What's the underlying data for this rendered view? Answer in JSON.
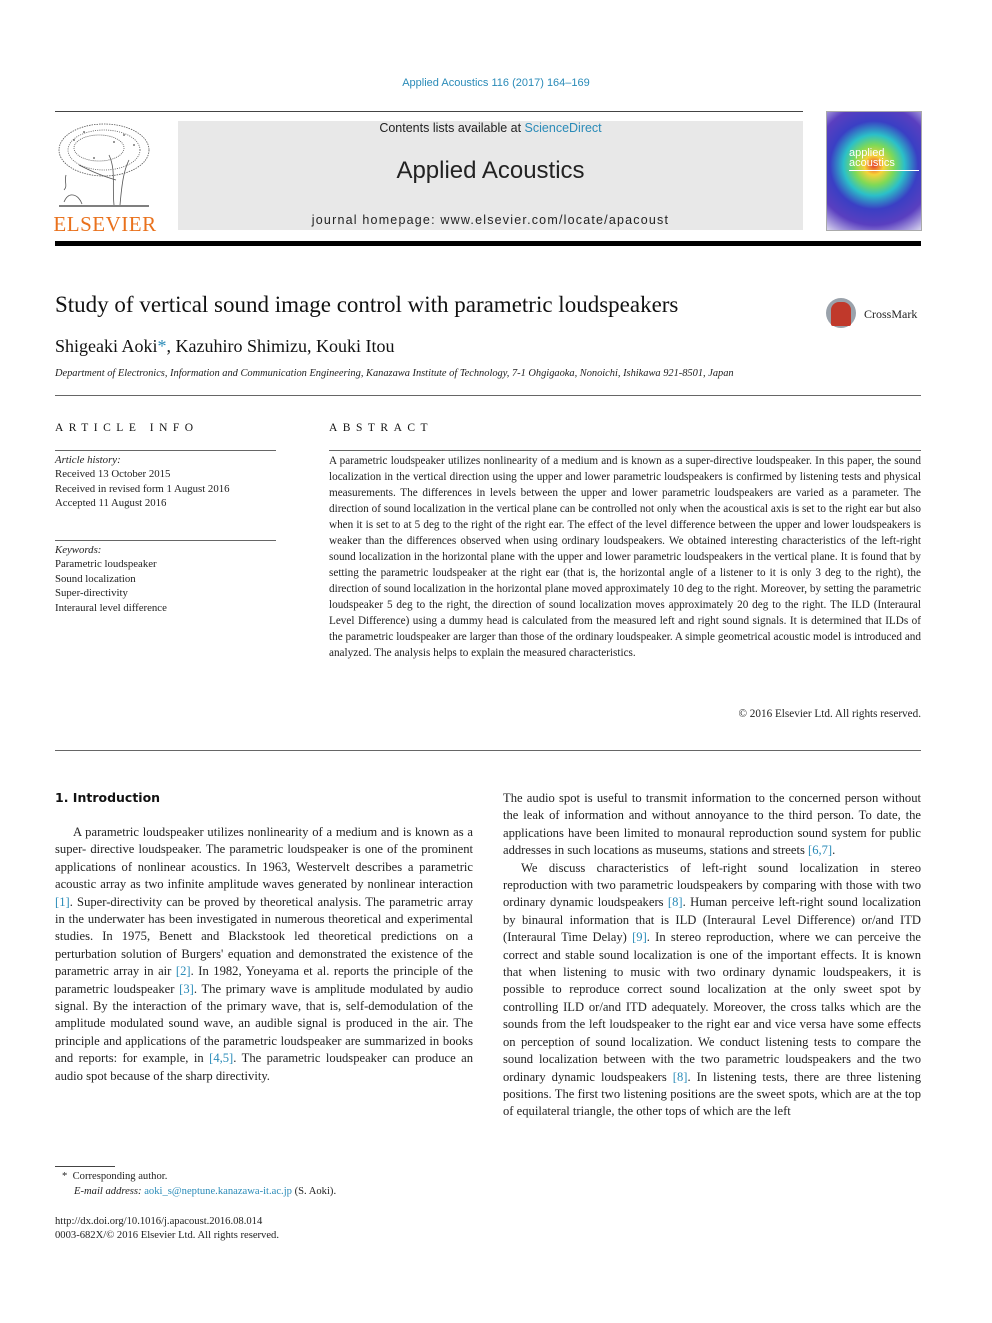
{
  "journal_ref": "Applied Acoustics 116 (2017) 164–169",
  "header": {
    "contents_prefix": "Contents lists available at ",
    "contents_link": "ScienceDirect",
    "journal_name": "Applied Acoustics",
    "homepage": "journal homepage: www.elsevier.com/locate/apacoust",
    "publisher_logo_text": "ELSEVIER",
    "cover_title_line1": "applied",
    "cover_title_line2": "acoustics"
  },
  "colors": {
    "link": "#2a8bb8",
    "elsevier_orange": "#e9711c",
    "header_bg": "#e8e8e8"
  },
  "article": {
    "title": "Study of vertical sound image control with parametric loudspeakers",
    "crossmark_label": "CrossMark",
    "authors_text": "Shigeaki Aoki",
    "author_star": "*",
    "authors_rest": ", Kazuhiro Shimizu, Kouki Itou",
    "affiliation": "Department of Electronics, Information and Communication Engineering, Kanazawa Institute of Technology, 7-1 Ohgigaoka, Nonoichi, Ishikawa 921-8501, Japan"
  },
  "article_info": {
    "heading": "ARTICLE INFO",
    "history_label": "Article history:",
    "history": [
      "Received 13 October 2015",
      "Received in revised form 1 August 2016",
      "Accepted 11 August 2016"
    ],
    "keywords_label": "Keywords:",
    "keywords": [
      "Parametric loudspeaker",
      "Sound localization",
      "Super-directivity",
      "Interaural level difference"
    ]
  },
  "abstract": {
    "heading": "ABSTRACT",
    "text": "A parametric loudspeaker utilizes nonlinearity of a medium and is known as a super-directive loudspeaker. In this paper, the sound localization in the vertical direction using the upper and lower parametric loudspeakers is confirmed by listening tests and physical measurements. The differences in levels between the upper and lower parametric loudspeakers are varied as a parameter. The direction of sound localization in the vertical plane can be controlled not only when the acoustical axis is set to the right ear but also when it is set to at 5 deg to the right of the right ear. The effect of the level difference between the upper and lower loudspeakers is weaker than the differences observed when using ordinary loudspeakers. We obtained interesting characteristics of the left-right sound localization in the horizontal plane with the upper and lower parametric loudspeakers in the vertical plane. It is found that by setting the parametric loudspeaker at the right ear (that is, the horizontal angle of a listener to it is only 3 deg to the right), the direction of sound localization in the horizontal plane moved approximately 10 deg to the right. Moreover, by setting the parametric loudspeaker 5 deg to the right, the direction of sound localization moves approximately 20 deg to the right. The ILD (Interaural Level Difference) using a dummy head is calculated from the measured left and right sound signals. It is determined that ILDs of the parametric loudspeaker are larger than those of the ordinary loudspeaker. A simple geometrical acoustic model is introduced and analyzed. The analysis helps to explain the measured characteristics.",
    "copyright": "© 2016 Elsevier Ltd. All rights reserved."
  },
  "body": {
    "section_title": "1. Introduction",
    "left_para": [
      {
        "t": "A parametric loudspeaker utilizes nonlinearity of a medium and is known as a super- directive loudspeaker. The parametric loudspeaker is one of the prominent applications of nonlinear acoustics. In 1963, Westervelt describes a parametric acoustic array as two infinite amplitude waves generated by nonlinear interaction "
      },
      {
        "ref": "[1]"
      },
      {
        "t": ". Super-directivity can be proved by theoretical analysis. The parametric array in the underwater has been investigated in numerous theoretical and experimental studies. In 1975, Benett and Blackstook led theoretical predictions on a perturbation solution of Burgers' equation and demonstrated the existence of the parametric array in air "
      },
      {
        "ref": "[2]"
      },
      {
        "t": ". In 1982, Yoneyama et al. reports the principle of the parametric loudspeaker "
      },
      {
        "ref": "[3]"
      },
      {
        "t": ". The primary wave is amplitude modulated by audio signal. By the interaction of the primary wave, that is, self-demodulation of the amplitude modulated sound wave, an audible signal is produced in the air. The principle and applications of the parametric loudspeaker are summarized in books and reports: for example, in "
      },
      {
        "ref": "[4,5]"
      },
      {
        "t": ". The parametric loudspeaker can produce an audio spot because of the sharp directivity."
      }
    ],
    "right_para1": [
      {
        "t": "The audio spot is useful to transmit information to the concerned person without the leak of information and without annoyance to the third person. To date, the applications have been limited to monaural reproduction sound system for public addresses in such locations as museums, stations and streets "
      },
      {
        "ref": "[6,7]"
      },
      {
        "t": "."
      }
    ],
    "right_para2": [
      {
        "t": "We discuss characteristics of left-right sound localization in stereo reproduction with two parametric loudspeakers by comparing with those with two ordinary dynamic loudspeakers "
      },
      {
        "ref": "[8]"
      },
      {
        "t": ". Human perceive left-right sound localization by binaural information that is ILD (Interaural Level Difference) or/and ITD (Interaural Time Delay) "
      },
      {
        "ref": "[9]"
      },
      {
        "t": ". In stereo reproduction, where we can perceive the correct and stable sound localization is one of the important effects. It is known that when listening to music with two ordinary dynamic loudspeakers, it is possible to reproduce correct sound localization at the only sweet spot by controlling ILD or/and ITD adequately. Moreover, the cross talks which are the sounds from the left loudspeaker to the right ear and vice versa have some effects on perception of sound localization. We conduct listening tests to compare the sound localization between with the two parametric loudspeakers and the two ordinary dynamic loudspeakers "
      },
      {
        "ref": "[8]"
      },
      {
        "t": ". In listening tests, there are three listening positions. The first two listening positions are the sweet spots, which are at the top of equilateral triangle, the other tops of which are the left"
      }
    ]
  },
  "footnotes": {
    "star": "*",
    "corresponding": "Corresponding author.",
    "email_label": "E-mail address:",
    "email": "aoki_s@neptune.kanazawa-it.ac.jp",
    "email_suffix": " (S. Aoki).",
    "doi": "http://dx.doi.org/10.1016/j.apacoust.2016.08.014",
    "issn": "0003-682X/© 2016 Elsevier Ltd. All rights reserved."
  }
}
